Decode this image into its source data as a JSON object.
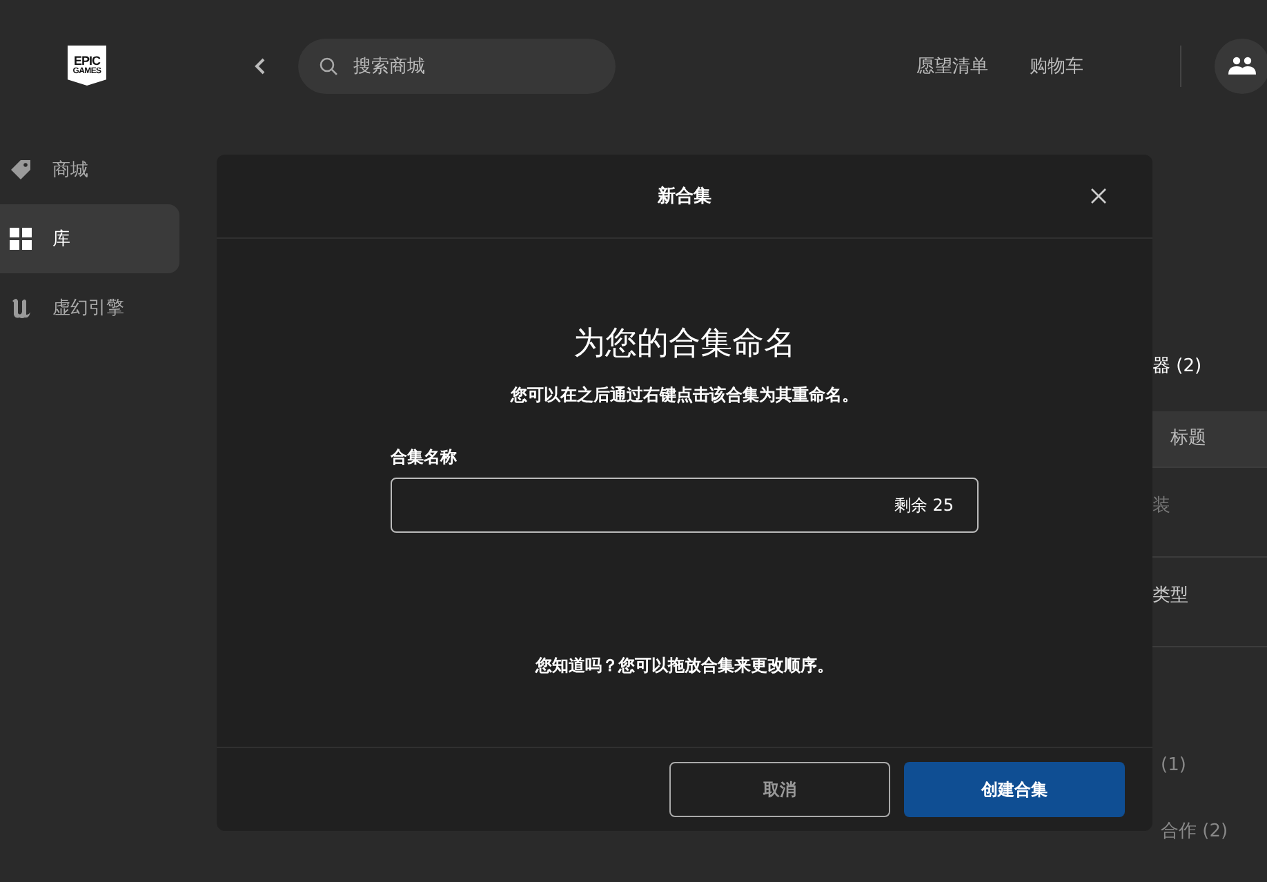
{
  "logo": {
    "line1": "EPIC",
    "line2": "GAMES"
  },
  "sidebar": {
    "items": [
      {
        "label": "商城",
        "selected": false
      },
      {
        "label": "库",
        "selected": true
      },
      {
        "label": "虚幻引擎",
        "selected": false
      }
    ]
  },
  "topbar": {
    "search": {
      "placeholder": "搜索商城"
    },
    "links": [
      "愿望清单",
      "购物车"
    ]
  },
  "filters": [
    {
      "kind": "heading",
      "label": "器 (2)"
    },
    {
      "kind": "sort",
      "label": "标题",
      "selected": true
    },
    {
      "kind": "option",
      "label": "装",
      "disabled": true
    },
    {
      "kind": "option",
      "label": "类型",
      "disabled": false
    },
    {
      "kind": "count",
      "label": "(1)"
    },
    {
      "kind": "count",
      "label": "合作 (2)"
    }
  ],
  "dialog": {
    "title": "新合集",
    "heading": "为您的合集命名",
    "subtitle": "您可以在之后通过右键点击该合集为其重命名。",
    "field": {
      "label": "合集名称",
      "counter": "剩余 25"
    },
    "tip": "您知道吗？您可以拖放合集来更改顺序。",
    "buttons": [
      {
        "label": "取消",
        "kind": "secondary"
      },
      {
        "label": "创建合集",
        "kind": "primary"
      }
    ]
  }
}
